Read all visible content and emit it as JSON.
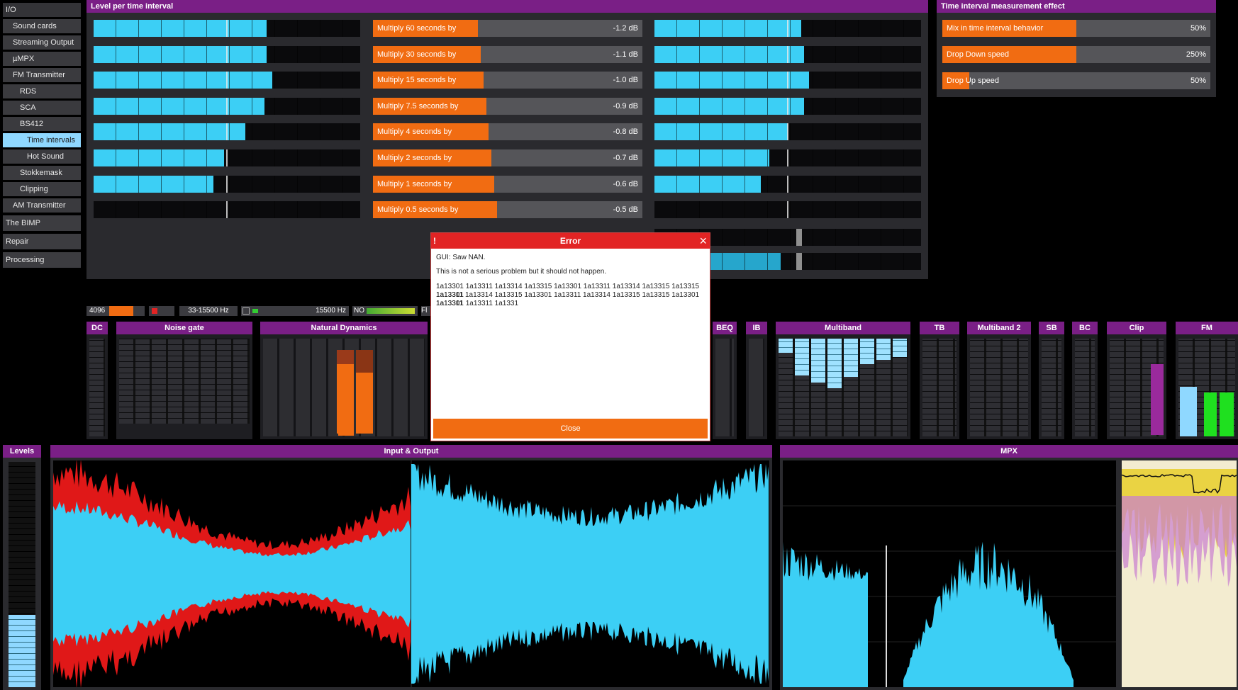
{
  "sidebar": {
    "items": [
      {
        "label": "I/O"
      },
      {
        "label": "Sound cards"
      },
      {
        "label": "Streaming Output"
      },
      {
        "label": "µMPX"
      },
      {
        "label": "FM Transmitter"
      },
      {
        "label": "RDS"
      },
      {
        "label": "SCA"
      },
      {
        "label": "BS412"
      },
      {
        "label": "Time intervals"
      },
      {
        "label": "Hot Sound"
      },
      {
        "label": "Stokkemask"
      },
      {
        "label": "Clipping"
      },
      {
        "label": "AM Transmitter"
      }
    ],
    "categories": [
      {
        "label": "The BIMP"
      },
      {
        "label": "Repair"
      },
      {
        "label": "Processing"
      }
    ]
  },
  "level_panel": {
    "title": "Level per time interval",
    "left_meters": [
      0.65,
      0.65,
      0.67,
      0.64,
      0.57,
      0.49,
      0.45,
      0.0
    ],
    "right_meters": [
      0.55,
      0.56,
      0.58,
      0.56,
      0.5,
      0.43,
      0.4,
      0.0
    ],
    "sliders": [
      {
        "label": "Multiply 60 seconds by",
        "value": "-1.2 dB",
        "fill": 0.39
      },
      {
        "label": "Multiply 30 seconds by",
        "value": "-1.1 dB",
        "fill": 0.4
      },
      {
        "label": "Multiply 15 seconds by",
        "value": "-1.0 dB",
        "fill": 0.41
      },
      {
        "label": "Multiply 7.5 seconds by",
        "value": "-0.9 dB",
        "fill": 0.42
      },
      {
        "label": "Multiply 4 seconds by",
        "value": "-0.8 dB",
        "fill": 0.43
      },
      {
        "label": "Multiply 2 seconds by",
        "value": "-0.7 dB",
        "fill": 0.44
      },
      {
        "label": "Multiply 1 seconds by",
        "value": "-0.6 dB",
        "fill": 0.45
      },
      {
        "label": "Multiply 0.5 seconds by",
        "value": "-0.5 dB",
        "fill": 0.46
      }
    ]
  },
  "effect_panel": {
    "title": "Time interval measurement effect",
    "sliders": [
      {
        "label": "Mix in time interval behavior",
        "value": "50%",
        "fill": 0.5
      },
      {
        "label": "Drop Down speed",
        "value": "250%",
        "fill": 0.5
      },
      {
        "label": "Drop Up speed",
        "value": "50%",
        "fill": 0.1
      }
    ]
  },
  "status": {
    "buffer": "4096",
    "band": "33-15500 Hz",
    "freq": "15500 Hz",
    "no": "NO",
    "fl": "Fl"
  },
  "modules": [
    {
      "label": "DC"
    },
    {
      "label": "Noise gate"
    },
    {
      "label": "Natural Dynamics"
    },
    {
      "label": "BEQ"
    },
    {
      "label": "IB"
    },
    {
      "label": "Multiband"
    },
    {
      "label": "TB"
    },
    {
      "label": "Multiband 2"
    },
    {
      "label": "SB"
    },
    {
      "label": "BC"
    },
    {
      "label": "Clip"
    },
    {
      "label": "FM"
    }
  ],
  "bottom": {
    "levels": "Levels",
    "io": "Input & Output",
    "mpx": "MPX"
  },
  "dialog": {
    "title": "Error",
    "line1": "GUI: Saw NAN.",
    "line2": "This is not a serious problem but it should not happen.",
    "line3": "1a13301 1a13311 1a13314 1a13315 1a13301 1a13311 1a13314 1a13315 1a13315 1a13301",
    "line4": "1a13311 1a13314 1a13315 1a13301 1a13311 1a13314 1a13315 1a13315 1a13301 1a13311",
    "line5": "1a13301 1a13311 1a1331",
    "close": "Close"
  },
  "colors": {
    "accent": "#7a1f86",
    "cyan": "#3ccff5",
    "orange": "#f16c12",
    "error": "#e22424"
  }
}
